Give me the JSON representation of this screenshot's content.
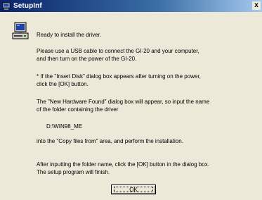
{
  "window": {
    "title": "SetupInf",
    "close_symbol": "x",
    "title_icon": "setup-window-icon"
  },
  "dialog": {
    "icon": "computer-icon",
    "lines": {
      "l1": "Ready to install the driver.",
      "l2a": "Please use a USB cable to connect the GI-20 and your computer,",
      "l2b": "and then turn on the power of the GI-20.",
      "l3a": "* If the \"Insert Disk\" dialog box appears after turning on the power,",
      "l3b": "click the [OK] button.",
      "l4a": "The \"New Hardware Found\" dialog box will appear, so input the name",
      "l4b": "of the folder containing the driver",
      "l5": "D:\\WIN98_ME",
      "l6": "into the \"Copy files from\" area, and perform the installation.",
      "l7a": "After inputting the folder name, click the [OK] button in the dialog box.",
      "l7b": "The setup program will finish."
    },
    "ok_label": "OK"
  }
}
